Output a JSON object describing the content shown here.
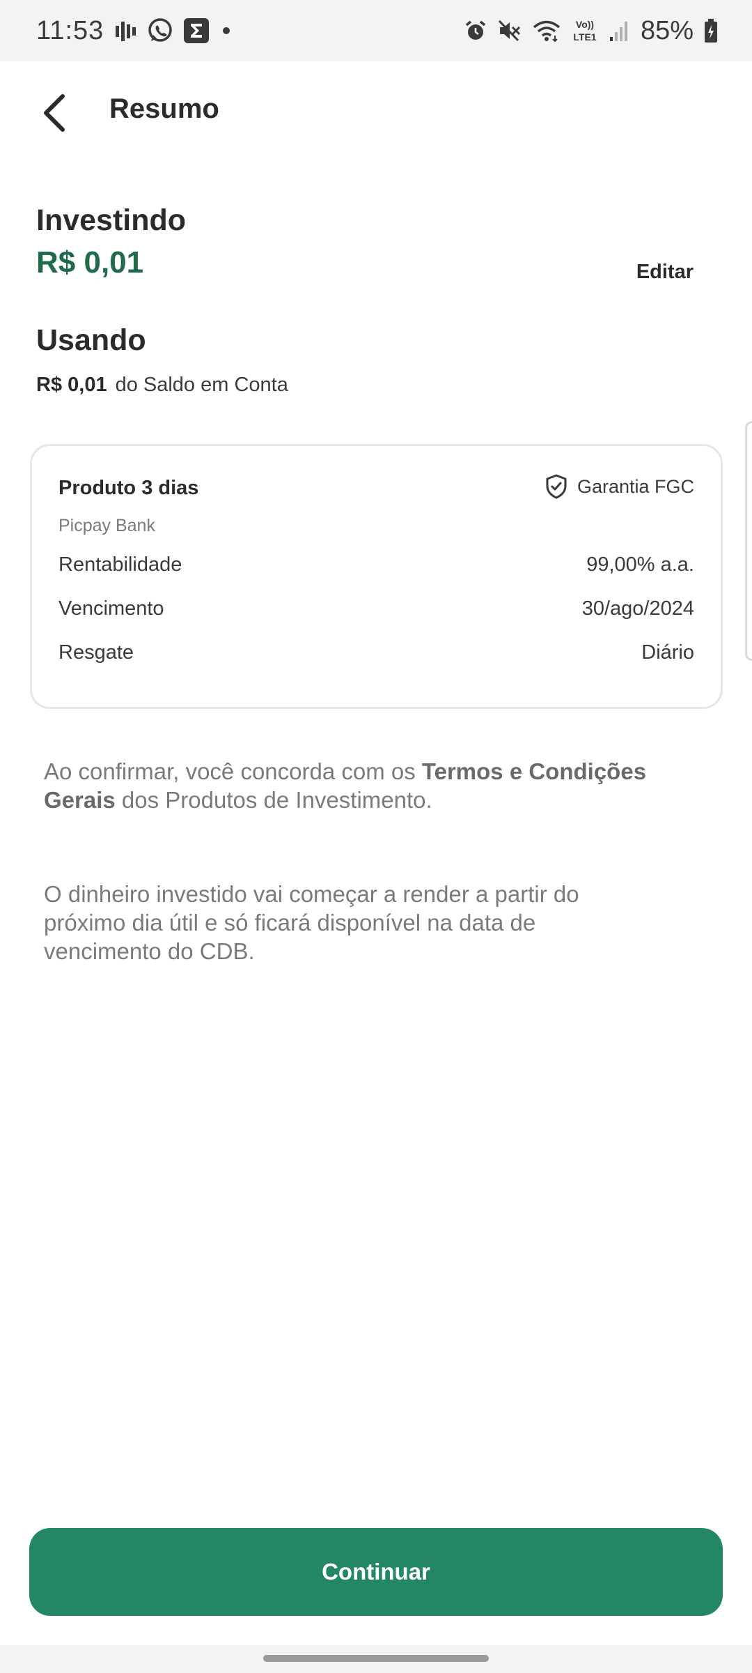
{
  "status_bar": {
    "time": "11:53",
    "battery": "85%",
    "left_icons": [
      "signal-bars-icon",
      "whatsapp-icon",
      "sigma-app-icon",
      "dot-icon"
    ],
    "right_icons": [
      "alarm-icon",
      "mute-icon",
      "wifi-icon",
      "volte-lte-icon",
      "cell-signal-icon",
      "battery-icon"
    ],
    "volte_text": "Vo))\nLTE1"
  },
  "header": {
    "title": "Resumo"
  },
  "investing": {
    "label": "Investindo",
    "value": "R$ 0,01",
    "edit_label": "Editar"
  },
  "using": {
    "label": "Usando",
    "amount": "R$ 0,01",
    "source": "do Saldo em Conta"
  },
  "product": {
    "title": "Produto 3 dias",
    "issuer": "Picpay Bank",
    "guarantee": "Garantia FGC",
    "rows": [
      {
        "label": "Rentabilidade",
        "value": "99,00% a.a."
      },
      {
        "label": "Vencimento",
        "value": "30/ago/2024"
      },
      {
        "label": "Resgate",
        "value": "Diário"
      }
    ]
  },
  "terms": {
    "prefix": "Ao confirmar, você concorda com os ",
    "link": "Termos e Condições Gerais",
    "suffix": " dos Produtos de Investimento."
  },
  "info": {
    "text": "O dinheiro investido vai começar a render a partir do próximo dia útil e só ficará disponível na data de vencimento do CDB."
  },
  "actions": {
    "continue_label": "Continuar"
  },
  "colors": {
    "accent_green": "#228762",
    "value_green": "#1f6b4a"
  }
}
